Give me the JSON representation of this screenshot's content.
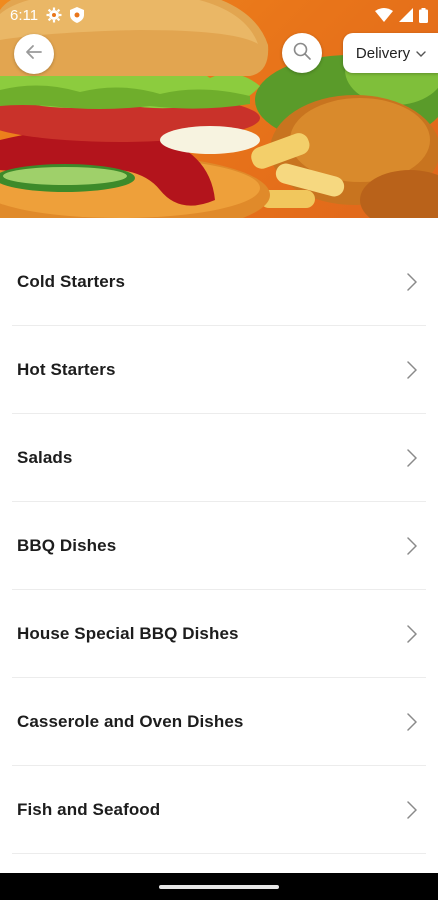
{
  "status_bar": {
    "time": "6:11",
    "icons": [
      "gear-icon",
      "shield-icon",
      "wifi-icon",
      "signal-icon",
      "battery-icon"
    ]
  },
  "header": {
    "back_icon": "arrow-left-icon",
    "search_icon": "search-icon",
    "delivery_label": "Delivery",
    "delivery_icon": "chevron-down-icon"
  },
  "menu": {
    "items": [
      {
        "label": "Cold Starters"
      },
      {
        "label": "Hot Starters"
      },
      {
        "label": "Salads"
      },
      {
        "label": "BBQ Dishes"
      },
      {
        "label": "House Special BBQ Dishes"
      },
      {
        "label": "Casserole and Oven Dishes"
      },
      {
        "label": "Fish and Seafood"
      }
    ]
  },
  "colors": {
    "hero_orange": "#e9761a",
    "text": "#1d1d1d",
    "divider": "#ececec"
  }
}
